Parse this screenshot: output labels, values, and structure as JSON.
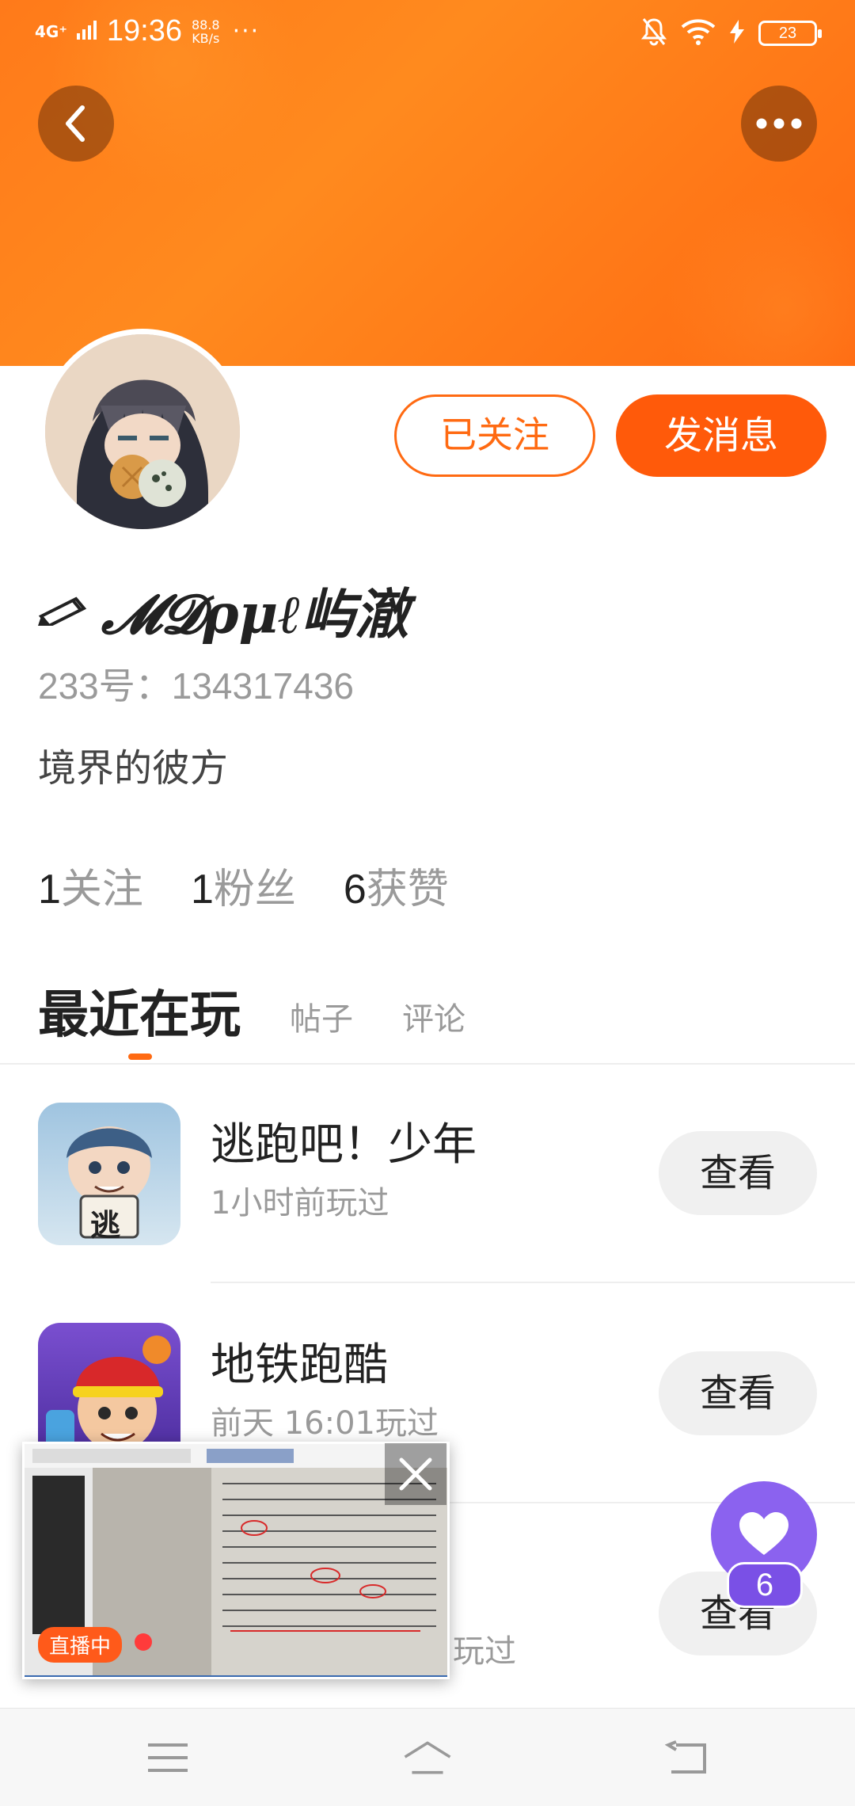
{
  "status_bar": {
    "network": "4G⁺",
    "time": "19:36",
    "speed_value": "88.8",
    "speed_unit": "KB/s",
    "more": "···",
    "battery": "23"
  },
  "profile": {
    "follow_label": "已关注",
    "message_label": "发消息",
    "username": "𝓜𝓓ρμℓ屿澈",
    "account_id": "233号：134317436",
    "bio": "境界的彼方",
    "stats": {
      "following_num": "1",
      "following_label": "关注",
      "fans_num": "1",
      "fans_label": "粉丝",
      "likes_num": "6",
      "likes_label": "获赞"
    }
  },
  "tabs": {
    "recent": "最近在玩",
    "posts": "帖子",
    "comments": "评论"
  },
  "games": [
    {
      "name": "逃跑吧！少年",
      "time": "1小时前玩过",
      "button": "查看",
      "icon_char": "逃"
    },
    {
      "name": "地铁跑酷",
      "time": "前天 16:01玩过",
      "button": "查看"
    },
    {
      "time_suffix": "玩过",
      "button": "查看"
    }
  ],
  "live": {
    "badge": "直播中"
  },
  "like_float": {
    "count": "6"
  },
  "colors": {
    "accent": "#ff6a12",
    "like": "#8b62ef"
  }
}
